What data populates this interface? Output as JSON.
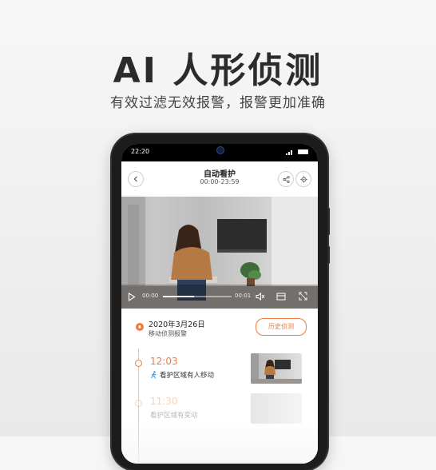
{
  "banner": {
    "headline": "AI 人形侦测",
    "subline": "有效过滤无效报警，报警更加准确"
  },
  "status_bar": {
    "time": "22:20"
  },
  "app_bar": {
    "title": "自动看护",
    "subtitle": "00:00-23:59"
  },
  "player": {
    "current_time": "00:00",
    "end_time": "00:01",
    "progress_fraction": 0.45
  },
  "event": {
    "date": "2020年3月26日",
    "type": "移动侦测报警",
    "history_button": "历史侦测"
  },
  "timeline": [
    {
      "time": "12:03",
      "desc": "看护区域有人移动",
      "icon": "person-walking-icon"
    },
    {
      "time": "11:30",
      "desc": "看护区域有变动",
      "icon": ""
    }
  ],
  "colors": {
    "accent": "#f07a3c",
    "text": "#222222"
  }
}
